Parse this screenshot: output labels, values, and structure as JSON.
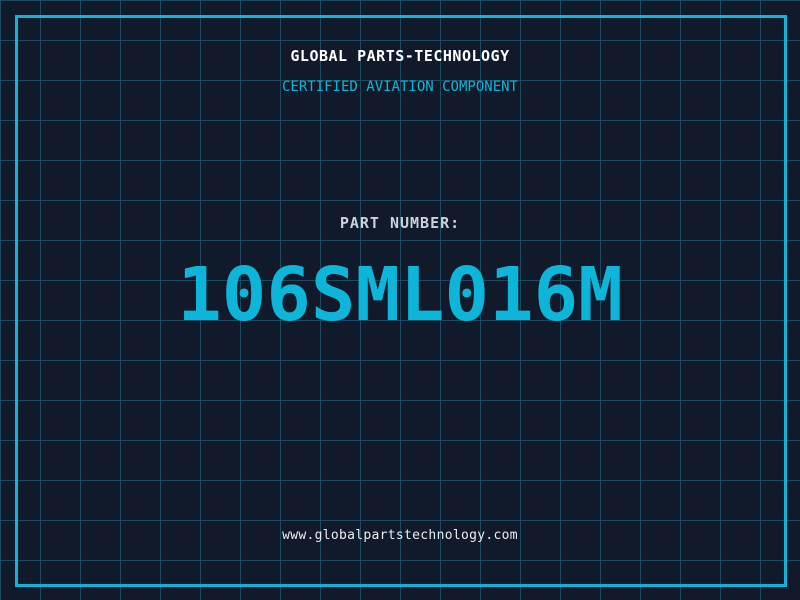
{
  "header": {
    "title": "GLOBAL PARTS-TECHNOLOGY",
    "subtitle": "CERTIFIED AVIATION COMPONENT"
  },
  "part": {
    "label": "PART NUMBER:",
    "number": "106SML016M"
  },
  "footer": {
    "website": "www.globalpartstechnology.com"
  },
  "colors": {
    "background": "#101a2a",
    "grid_line": "#1b4a63",
    "accent_cyan": "#0db5d9",
    "text_white": "#ffffff",
    "text_gray": "#c9d4da"
  }
}
